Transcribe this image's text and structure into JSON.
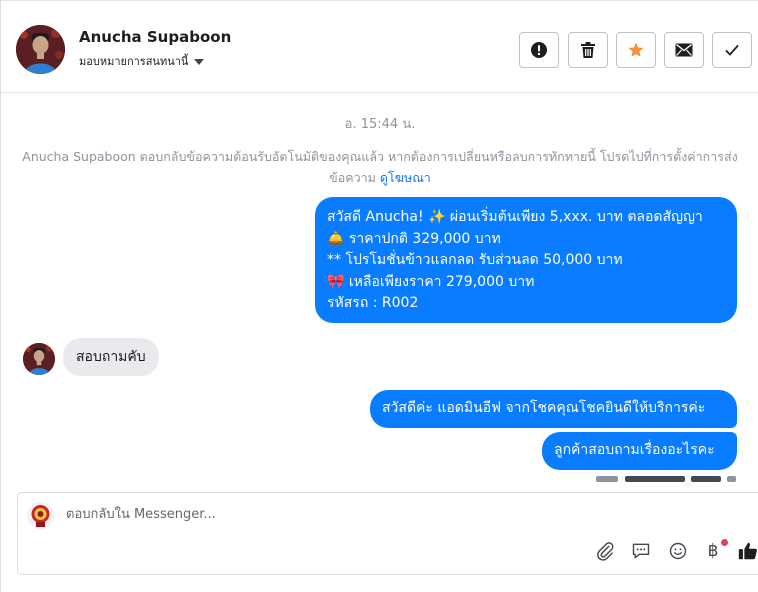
{
  "header": {
    "contact_name": "Anucha Supaboon",
    "assign_label": "มอบหมายการสนทนานี้",
    "actions": [
      {
        "icon": "alert-circle-icon",
        "name": "mark-spam-button"
      },
      {
        "icon": "trash-icon",
        "name": "delete-button"
      },
      {
        "icon": "star-icon",
        "name": "star-button",
        "color": "#f7923b"
      },
      {
        "icon": "envelope-icon",
        "name": "mark-unread-button"
      },
      {
        "icon": "checkmark-icon",
        "name": "mark-done-button"
      }
    ]
  },
  "conversation": {
    "timestamp": "อ. 15:44 น.",
    "system_note": {
      "text": "Anucha Supaboon ตอบกลับข้อความต้อนรับอัตโนมัติของคุณแล้ว หากต้องการเปลี่ยนหรือลบการทักทายนี้ โปรดไปที่การตั้งค่าการส่งข้อความ",
      "link": "ดูโฆษณา"
    },
    "outgoing_promo": {
      "line1": "สวัสดี Anucha! ✨  ผ่อนเริ่มต้นเพียง 5,xxx. บาท ตลอดสัญญา",
      "line2": "🛎️ ราคาปกติ  329,000 บาท",
      "line3": "** โปรโมชั่นข้าวแลกลด รับส่วนลด 50,000 บาท",
      "line4": "🎀  เหลือเพียงราคา 279,000 บาท",
      "line5": " รหัสรถ : R002"
    },
    "incoming_message": "สอบถามคับ",
    "outgoing_reply_1": "สวัสดีค่ะ แอดมินอีฟ จากโชคคุณโชคยินดีให้บริการค่ะ",
    "outgoing_reply_2": "ลูกค้าสอบถามเรื่องอะไรคะ"
  },
  "composer": {
    "placeholder": "ตอบกลับใน Messenger...",
    "value": "",
    "tools": [
      "paperclip-icon",
      "saved-replies-icon",
      "emoji-icon",
      "baht-payment-icon",
      "thumbs-up-icon"
    ],
    "baht_symbol": "฿"
  },
  "colors": {
    "outgoing_bubble": "#0a7cff",
    "incoming_bubble": "#e9e9ee",
    "star": "#f7923b",
    "link": "#1877f2",
    "notification_dot": "#e4405f"
  }
}
